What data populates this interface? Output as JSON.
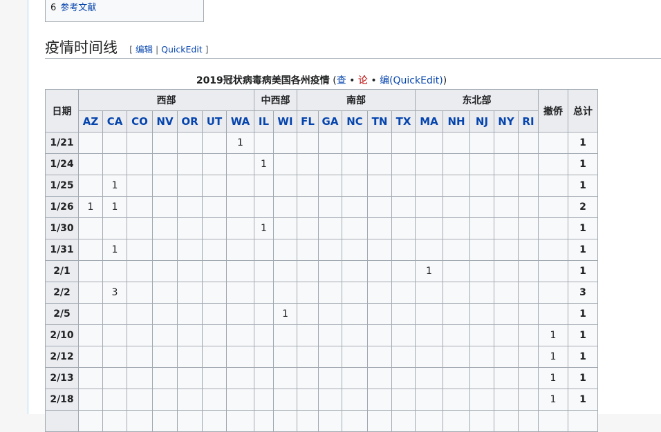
{
  "toc": {
    "number": "6",
    "label": "参考文献"
  },
  "section": {
    "title": "疫情时间线",
    "bracket_open": "[ ",
    "edit_label": "编辑",
    "separator": " | ",
    "quickedit_label": "QuickEdit",
    "bracket_close": " ]"
  },
  "caption": {
    "title": "2019冠状病毒病美国各州疫情",
    "open": " (",
    "view": "查",
    "dot1": " • ",
    "talk": "论",
    "dot2": " • ",
    "edit": "编",
    "quickedit": "(QuickEdit)",
    "close": ")"
  },
  "table": {
    "date_header": "日期",
    "regions": [
      {
        "name": "西部",
        "span": 7
      },
      {
        "name": "中西部",
        "span": 2
      },
      {
        "name": "南部",
        "span": 5
      },
      {
        "name": "东北部",
        "span": 5
      }
    ],
    "evacuated_header": "撤侨",
    "total_header": "总计",
    "states": [
      "AZ",
      "CA",
      "CO",
      "NV",
      "OR",
      "UT",
      "WA",
      "IL",
      "WI",
      "FL",
      "GA",
      "NC",
      "TN",
      "TX",
      "MA",
      "NH",
      "NJ",
      "NY",
      "RI"
    ],
    "rows": [
      {
        "date": "1/21",
        "cells": {
          "WA": "1"
        },
        "evac": "",
        "total": "1"
      },
      {
        "date": "1/24",
        "cells": {
          "IL": "1"
        },
        "evac": "",
        "total": "1"
      },
      {
        "date": "1/25",
        "cells": {
          "CA": "1"
        },
        "evac": "",
        "total": "1"
      },
      {
        "date": "1/26",
        "cells": {
          "AZ": "1",
          "CA": "1"
        },
        "evac": "",
        "total": "2"
      },
      {
        "date": "1/30",
        "cells": {
          "IL": "1"
        },
        "evac": "",
        "total": "1"
      },
      {
        "date": "1/31",
        "cells": {
          "CA": "1"
        },
        "evac": "",
        "total": "1"
      },
      {
        "date": "2/1",
        "cells": {
          "MA": "1"
        },
        "evac": "",
        "total": "1"
      },
      {
        "date": "2/2",
        "cells": {
          "CA": "3"
        },
        "evac": "",
        "total": "3"
      },
      {
        "date": "2/5",
        "cells": {
          "WI": "1"
        },
        "evac": "",
        "total": "1"
      },
      {
        "date": "2/10",
        "cells": {},
        "evac": "1",
        "total": "1"
      },
      {
        "date": "2/12",
        "cells": {},
        "evac": "1",
        "total": "1"
      },
      {
        "date": "2/13",
        "cells": {},
        "evac": "1",
        "total": "1"
      },
      {
        "date": "2/18",
        "cells": {},
        "evac": "1",
        "total": "1"
      },
      {
        "date": "",
        "cells": {},
        "evac": "",
        "total": ""
      }
    ]
  }
}
